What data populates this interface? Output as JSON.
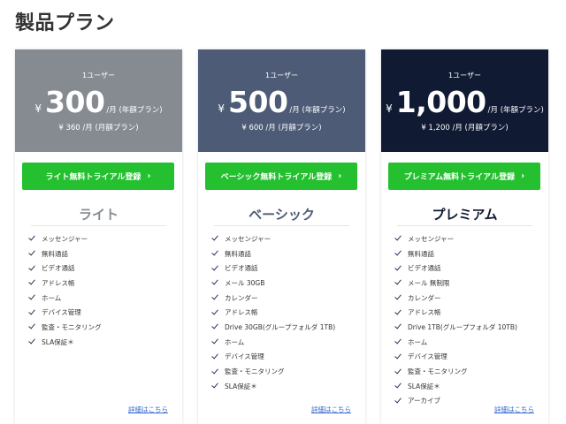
{
  "page": {
    "title": "製品プラン"
  },
  "plans": [
    {
      "per_user": "1ユーザー",
      "yen": "¥",
      "price": "300",
      "unit": "/月 (年額プラン)",
      "monthly_price": "¥ 360 /月 (月額プラン)",
      "trial_button": "ライト無料トライアル登録",
      "name": "ライト",
      "features": [
        "メッセンジャー",
        "無料通話",
        "ビデオ通話",
        "アドレス帳",
        "ホーム",
        "デバイス管理",
        "監査・モニタリング",
        "SLA保証＊"
      ],
      "detail_link": "詳細はこちら"
    },
    {
      "per_user": "1ユーザー",
      "yen": "¥",
      "price": "500",
      "unit": "/月 (年額プラン)",
      "monthly_price": "¥ 600 /月 (月額プラン)",
      "trial_button": "ベーシック無料トライアル登録",
      "name": "ベーシック",
      "features": [
        "メッセンジャー",
        "無料通話",
        "ビデオ通話",
        "メール 30GB",
        "カレンダー",
        "アドレス帳",
        "Drive 30GB(グループフォルダ 1TB)",
        "ホーム",
        "デバイス管理",
        "監査・モニタリング",
        "SLA保証＊"
      ],
      "detail_link": "詳細はこちら"
    },
    {
      "per_user": "1ユーザー",
      "yen": "¥",
      "price": "1,000",
      "unit": "/月 (年額プラン)",
      "monthly_price": "¥ 1,200 /月 (月額プラン)",
      "trial_button": "プレミアム無料トライアル登録",
      "name": "プレミアム",
      "features": [
        "メッセンジャー",
        "無料通話",
        "ビデオ通話",
        "メール 無制限",
        "カレンダー",
        "アドレス帳",
        "Drive 1TB(グループフォルダ 10TB)",
        "ホーム",
        "デバイス管理",
        "監査・モニタリング",
        "SLA保証＊",
        "アーカイブ"
      ],
      "detail_link": "詳細はこちら"
    }
  ],
  "colors": {
    "light": "#868b92",
    "basic": "#4d5b76",
    "premium": "#101a33",
    "button": "#24c02f",
    "link": "#3366cc"
  },
  "icons": {
    "check": "check-icon",
    "chevron": "chevron-right-icon"
  }
}
